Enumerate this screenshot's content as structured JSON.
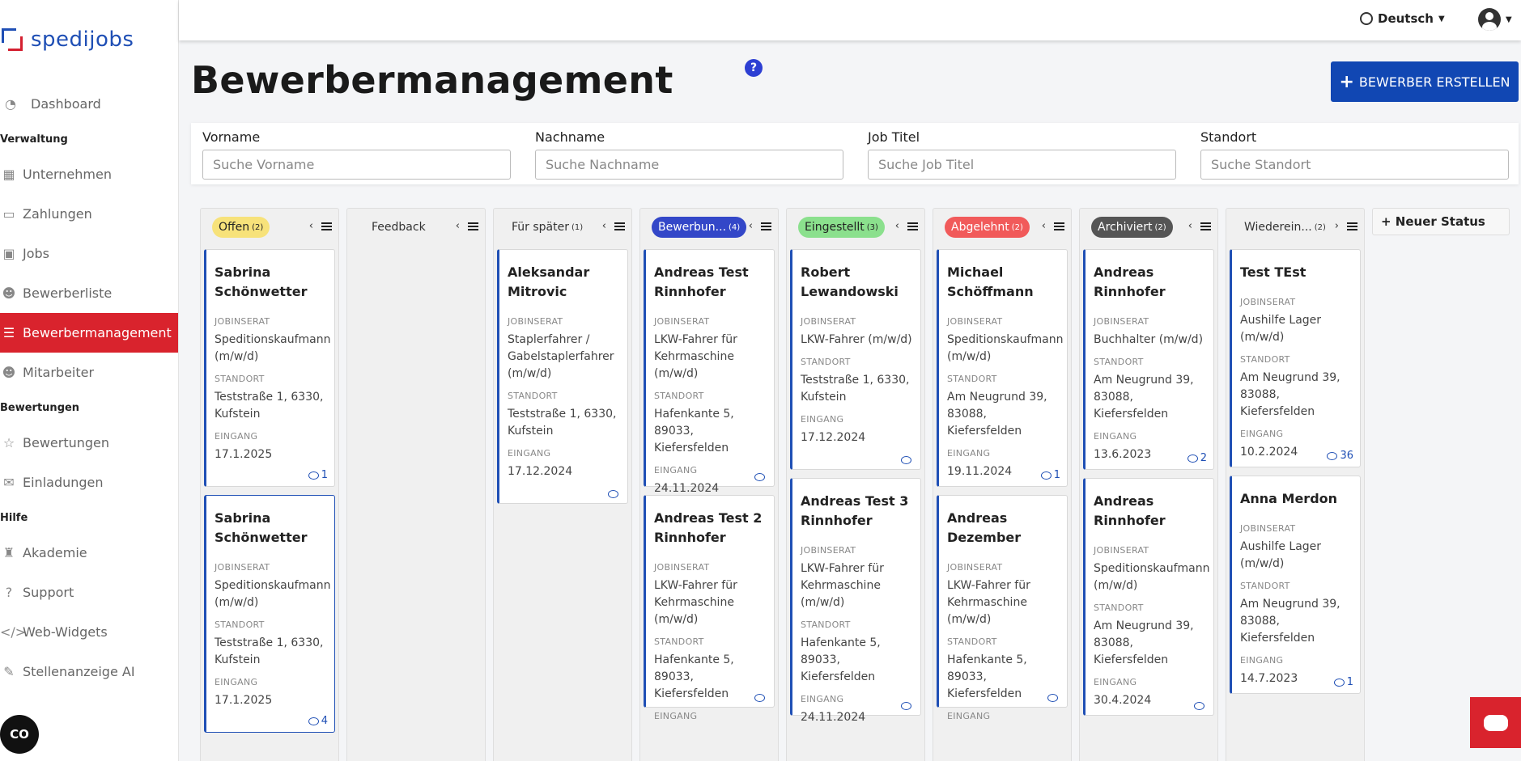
{
  "app": {
    "brand": "spedijobs",
    "brand_color": "#1f4fb5",
    "accent": "#d9232d"
  },
  "topbar": {
    "language": "Deutsch"
  },
  "sidebar": {
    "items": [
      {
        "label": "Dashboard",
        "icon": "dashboard-icon"
      },
      {
        "section": "Verwaltung"
      },
      {
        "label": "Unternehmen",
        "icon": "building-icon"
      },
      {
        "label": "Zahlungen",
        "icon": "credit-card-icon"
      },
      {
        "label": "Jobs",
        "icon": "briefcase-icon"
      },
      {
        "label": "Bewerberliste",
        "icon": "user-list-icon"
      },
      {
        "label": "Bewerbermanagement",
        "icon": "list-icon",
        "active": true
      },
      {
        "label": "Mitarbeiter",
        "icon": "users-icon"
      },
      {
        "section": "Bewertungen"
      },
      {
        "label": "Bewertungen",
        "icon": "star-icon"
      },
      {
        "label": "Einladungen",
        "icon": "envelope-icon"
      },
      {
        "section": "Hilfe"
      },
      {
        "label": "Akademie",
        "icon": "graduation-icon"
      },
      {
        "label": "Support",
        "icon": "question-icon"
      },
      {
        "label": "Web-Widgets",
        "icon": "code-icon"
      },
      {
        "label": "Stellenanzeige AI",
        "icon": "magic-wand-icon"
      }
    ],
    "cookie_label": "CO"
  },
  "header": {
    "title": "Bewerbermanagement",
    "help": "?",
    "create_label": "BEWERBER ERSTELLEN"
  },
  "filters": [
    {
      "label": "Vorname",
      "placeholder": "Suche Vorname"
    },
    {
      "label": "Nachname",
      "placeholder": "Suche Nachname"
    },
    {
      "label": "Job Titel",
      "placeholder": "Suche Job Titel"
    },
    {
      "label": "Standort",
      "placeholder": "Suche Standort"
    }
  ],
  "labels": {
    "jobinserat": "JOBINSERAT",
    "standort": "STANDORT",
    "eingang": "EINGANG"
  },
  "columns": [
    {
      "title": "Offen",
      "count": "(2)",
      "color": "#f7e27a",
      "text_color": "#222",
      "nav": "‹",
      "cards": [
        {
          "name": "Sabrina Schönwetter",
          "job": "Speditionskaufmann (m/w/d)",
          "standort": "Teststraße 1, 6330, Kufstein",
          "eingang": "17.1.2025",
          "comments": "1"
        },
        {
          "name": "Sabrina Schönwetter",
          "job": "Speditionskaufmann (m/w/d)",
          "standort": "Teststraße 1, 6330, Kufstein",
          "eingang": "17.1.2025",
          "comments": "4",
          "selected": true
        }
      ]
    },
    {
      "title": "Feedback",
      "count": "",
      "color": "",
      "text_color": "#333",
      "nav": "‹",
      "cards": []
    },
    {
      "title": "Für später",
      "count": "(1)",
      "color": "",
      "text_color": "#333",
      "nav": "‹",
      "cards": [
        {
          "name": "Aleksandar Mitrovic",
          "job": "Staplerfahrer / Gabelstaplerfahrer (m/w/d)",
          "standort": "Teststraße 1, 6330, Kufstein",
          "eingang": "17.12.2024",
          "comments": ""
        }
      ]
    },
    {
      "title": "Bewerbun...",
      "count": "(4)",
      "color": "#3347c8",
      "text_color": "#fff",
      "nav": "‹",
      "cards": [
        {
          "name": "Andreas Test Rinnhofer",
          "job": "LKW-Fahrer für Kehrmaschine (m/w/d)",
          "standort": "Hafenkante 5, 89033, Kiefersfelden",
          "eingang": "24.11.2024",
          "comments": ""
        },
        {
          "name": "Andreas Test 2 Rinnhofer",
          "job": "LKW-Fahrer für Kehrmaschine (m/w/d)",
          "standort": "Hafenkante 5, 89033, Kiefersfelden",
          "eingang": "",
          "comments": ""
        }
      ]
    },
    {
      "title": "Eingestellt",
      "count": "(3)",
      "color": "#8be08d",
      "text_color": "#222",
      "nav": "‹",
      "cards": [
        {
          "name": "Robert Lewandowski",
          "job": "LKW-Fahrer (m/w/d)",
          "standort": "Teststraße 1, 6330, Kufstein",
          "eingang": "17.12.2024",
          "comments": ""
        },
        {
          "name": "Andreas Test 3 Rinnhofer",
          "job": "LKW-Fahrer für Kehrmaschine (m/w/d)",
          "standort": "Hafenkante 5, 89033, Kiefersfelden",
          "eingang": "24.11.2024",
          "comments": ""
        }
      ]
    },
    {
      "title": "Abgelehnt",
      "count": "(2)",
      "color": "#f15a5a",
      "text_color": "#fff",
      "nav": "‹",
      "cards": [
        {
          "name": "Michael Schöffmann",
          "job": "Speditionskaufmann (m/w/d)",
          "standort": "Am Neugrund 39, 83088, Kiefersfelden",
          "eingang": "19.11.2024",
          "comments": "1"
        },
        {
          "name": "Andreas Dezember",
          "job": "LKW-Fahrer für Kehrmaschine (m/w/d)",
          "standort": "Hafenkante 5, 89033, Kiefersfelden",
          "eingang": "",
          "comments": ""
        }
      ]
    },
    {
      "title": "Archiviert",
      "count": "(2)",
      "color": "#555",
      "text_color": "#fff",
      "nav": "‹",
      "cards": [
        {
          "name": "Andreas Rinnhofer",
          "job": "Buchhalter (m/w/d)",
          "standort": "Am Neugrund 39, 83088, Kiefersfelden",
          "eingang": "13.6.2023",
          "comments": "2"
        },
        {
          "name": "Andreas Rinnhofer",
          "job": "Speditionskaufmann (m/w/d)",
          "standort": "Am Neugrund 39, 83088, Kiefersfelden",
          "eingang": "30.4.2024",
          "comments": ""
        }
      ]
    },
    {
      "title": "Wiederein...",
      "count": "(2)",
      "color": "",
      "text_color": "#333",
      "nav": "›",
      "cards": [
        {
          "name": "Test TEst",
          "job": "Aushilfe Lager (m/w/d)",
          "standort": "Am Neugrund 39, 83088, Kiefersfelden",
          "eingang": "10.2.2024",
          "comments": "36"
        },
        {
          "name": "Anna Merdon",
          "job": "Aushilfe Lager (m/w/d)",
          "standort": "Am Neugrund 39, 83088, Kiefersfelden",
          "eingang": "14.7.2023",
          "comments": "1"
        }
      ]
    }
  ],
  "new_status_label": "+ Neuer Status"
}
